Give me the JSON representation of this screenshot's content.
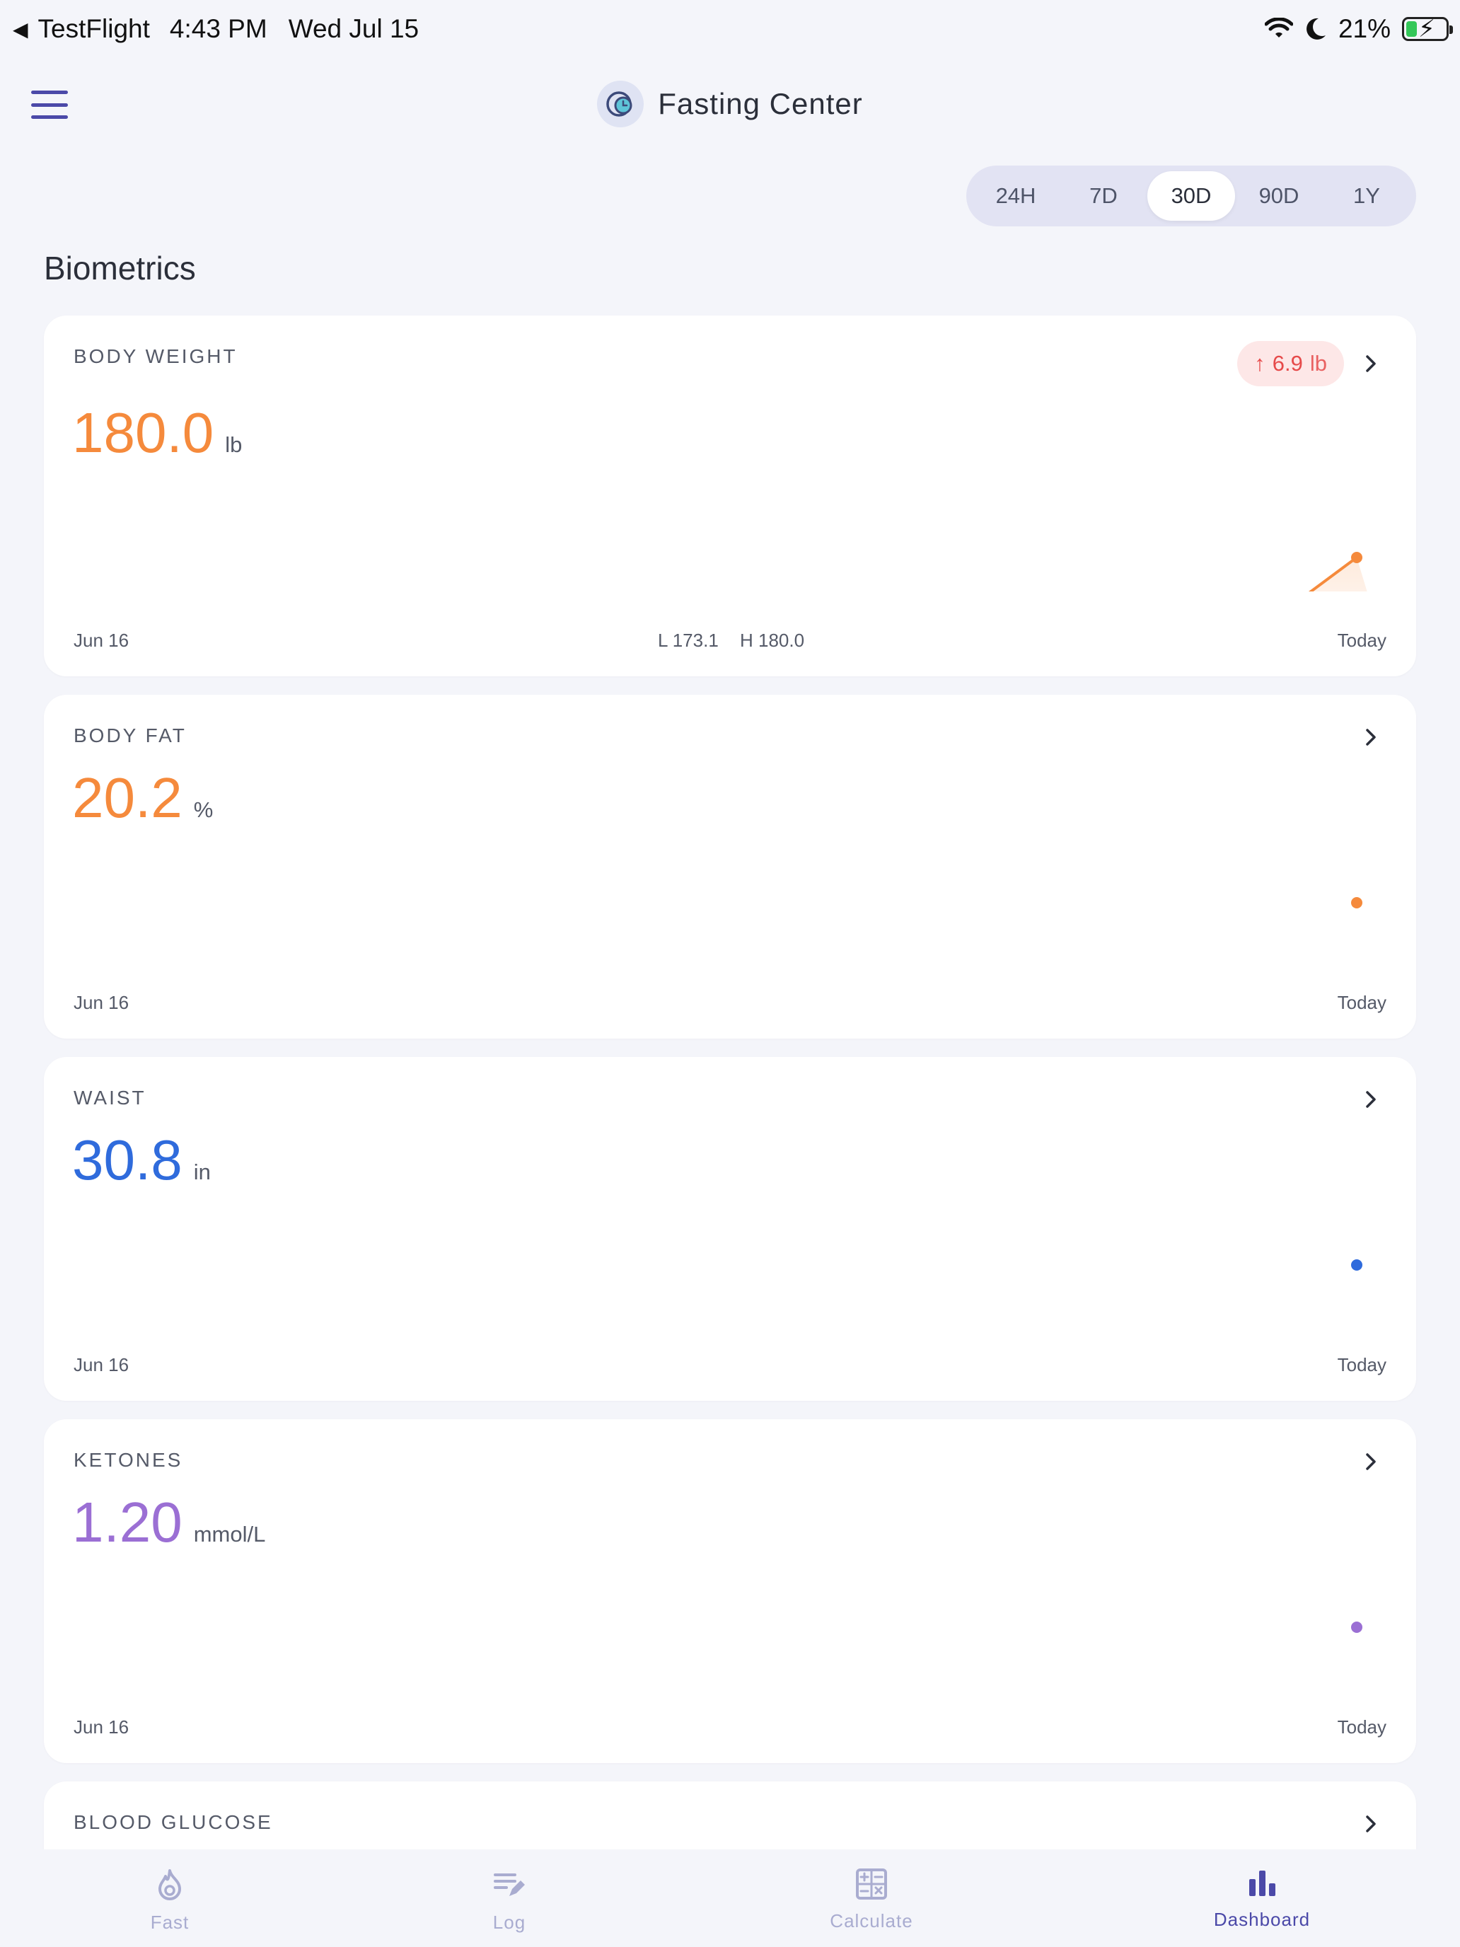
{
  "status_bar": {
    "back_app": "TestFlight",
    "time": "4:43 PM",
    "date": "Wed Jul 15",
    "battery": "21%"
  },
  "header": {
    "title": "Fasting Center"
  },
  "range": {
    "options": [
      "24H",
      "7D",
      "30D",
      "90D",
      "1Y"
    ],
    "selected": "30D"
  },
  "section_title": "Biometrics",
  "cards": {
    "weight": {
      "label": "BODY WEIGHT",
      "value": "180.0",
      "unit": "lb",
      "change": "6.9",
      "change_unit": "lb",
      "change_arrow": "↑",
      "low": "L 173.1",
      "high": "H 180.0",
      "start": "Jun 16",
      "end": "Today",
      "color": "#f58a3c",
      "points": [
        173.1,
        180.0
      ]
    },
    "fat": {
      "label": "BODY FAT",
      "value": "20.2",
      "unit": "%",
      "start": "Jun 16",
      "end": "Today",
      "color": "#f58a3c",
      "points": [
        20.2
      ]
    },
    "waist": {
      "label": "WAIST",
      "value": "30.8",
      "unit": "in",
      "start": "Jun 16",
      "end": "Today",
      "color": "#2f6bdc",
      "points": [
        30.8
      ]
    },
    "ketones": {
      "label": "KETONES",
      "value": "1.20",
      "unit": "mmol/L",
      "start": "Jun 16",
      "end": "Today",
      "color": "#9b6fd4",
      "points": [
        1.2
      ]
    },
    "glucose": {
      "label": "BLOOD GLUCOSE"
    }
  },
  "tabs": [
    {
      "label": "Fast",
      "icon": "flame-icon"
    },
    {
      "label": "Log",
      "icon": "edit-list-icon"
    },
    {
      "label": "Calculate",
      "icon": "calculator-icon"
    },
    {
      "label": "Dashboard",
      "icon": "bar-chart-icon",
      "active": true
    }
  ]
}
